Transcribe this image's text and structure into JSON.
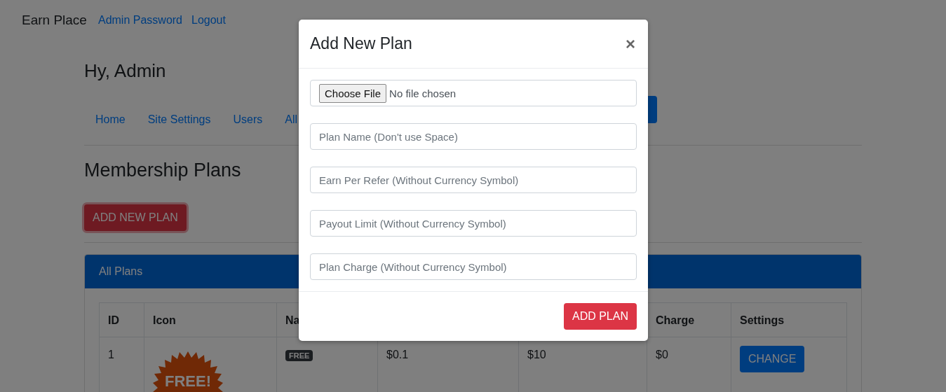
{
  "navbar": {
    "brand": "Earn Place",
    "links": [
      "Admin Password",
      "Logout"
    ]
  },
  "greeting": "Hy, Admin",
  "tabs": [
    {
      "label": "Home"
    },
    {
      "label": "Site Settings"
    },
    {
      "label": "Users"
    },
    {
      "label": "All"
    }
  ],
  "section_title": "Membership Plans",
  "add_button": "ADD NEW PLAN",
  "card": {
    "title": "All Plans",
    "table": {
      "columns": [
        "ID",
        "Icon",
        "Na",
        null,
        null,
        "Charge",
        "Settings"
      ],
      "rows": [
        {
          "id": "1",
          "icon_text": "FREE!",
          "name_badge": "FREE",
          "column_4": "$0.1",
          "column_5": "$10",
          "charge": "$0",
          "action": "CHANGE"
        }
      ]
    }
  },
  "modal": {
    "title": "Add New Plan",
    "close": "×",
    "file_input": {
      "button": "Choose File",
      "status": "No file chosen"
    },
    "fields": [
      {
        "placeholder": "Plan Name (Don't use Space)"
      },
      {
        "placeholder": "Earn Per Refer (Without Currency Symbol)"
      },
      {
        "placeholder": "Payout Limit (Without Currency Symbol)"
      },
      {
        "placeholder": "Plan Charge (Without Currency Symbol)"
      }
    ],
    "submit": "ADD PLAN"
  }
}
